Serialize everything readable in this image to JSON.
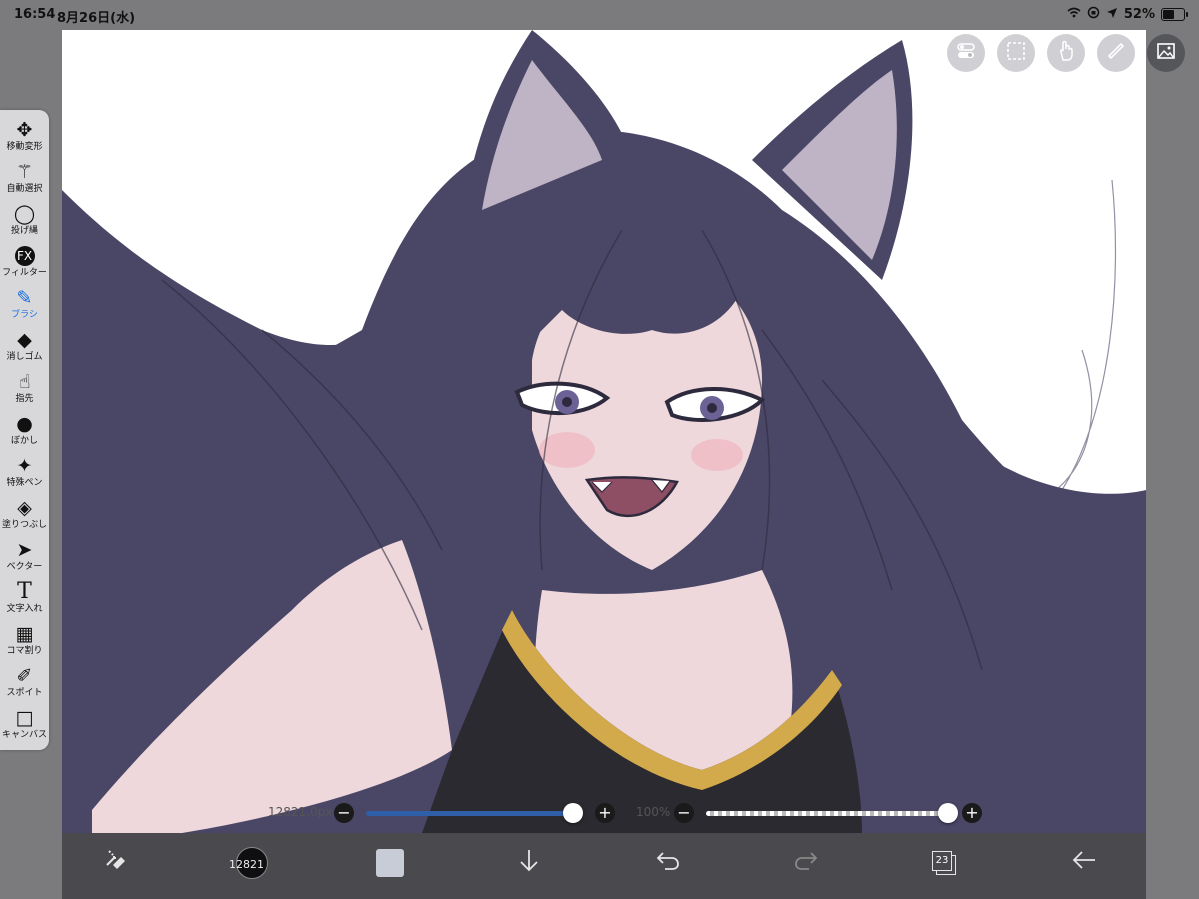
{
  "status_bar": {
    "time": "16:54",
    "date": "8月26日(水)",
    "battery": "52%"
  },
  "tools": [
    {
      "label": "移動変形",
      "icon": "move-transform-icon",
      "glyph": "✥"
    },
    {
      "label": "自動選択",
      "icon": "magic-wand-icon",
      "glyph": "⚚"
    },
    {
      "label": "投げ縄",
      "icon": "lasso-icon",
      "glyph": "◯"
    },
    {
      "label": "フィルター",
      "icon": "fx-filter-icon",
      "glyph": "FX"
    },
    {
      "label": "ブラシ",
      "icon": "brush-icon",
      "glyph": "✎",
      "active": true
    },
    {
      "label": "消しゴム",
      "icon": "eraser-icon",
      "glyph": "◆"
    },
    {
      "label": "指先",
      "icon": "smudge-finger-icon",
      "glyph": "☝"
    },
    {
      "label": "ぼかし",
      "icon": "blur-drop-icon",
      "glyph": "●"
    },
    {
      "label": "特殊ペン",
      "icon": "special-pen-sparkle-icon",
      "glyph": "✦"
    },
    {
      "label": "塗りつぶし",
      "icon": "fill-bucket-icon",
      "glyph": "◈"
    },
    {
      "label": "ベクター",
      "icon": "vector-arrow-icon",
      "glyph": "➤"
    },
    {
      "label": "文字入れ",
      "icon": "text-icon",
      "glyph": "T"
    },
    {
      "label": "コマ割り",
      "icon": "panel-divide-icon",
      "glyph": "▦"
    },
    {
      "label": "スポイト",
      "icon": "eyedropper-icon",
      "glyph": "✐"
    },
    {
      "label": "キャンバス",
      "icon": "canvas-icon",
      "glyph": "□"
    }
  ],
  "top_buttons": [
    "toggle-icon",
    "selection-icon",
    "gesture-hand-icon",
    "ruler-icon",
    "gallery-icon"
  ],
  "brush_size": {
    "label": "12821.0px",
    "value_fraction": 1.0
  },
  "opacity": {
    "label": "100%",
    "value_fraction": 1.0
  },
  "bottom_bar": {
    "brush_size_short": "12821",
    "layer_count": "23",
    "current_color": "#0f0f12",
    "secondary_color": "#c7ccd6"
  },
  "colors": {
    "accent": "#1b6fe0",
    "slider_fill": "#2f5fa8",
    "hair": "#4a4666",
    "skin": "#eed8db",
    "shirt_trim": "#d2a94b"
  }
}
